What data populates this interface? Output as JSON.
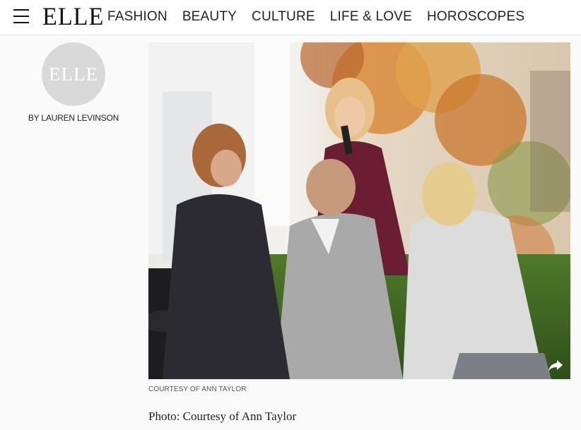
{
  "header": {
    "logo": "ELLE",
    "nav": [
      "FASHION",
      "BEAUTY",
      "CULTURE",
      "LIFE & LOVE",
      "HOROSCOPES"
    ]
  },
  "author": {
    "avatar_text": "ELLE",
    "byline": "BY LAUREN LEVINSON"
  },
  "article": {
    "image_credit": "COURTESY OF ANN TAYLOR",
    "caption": "Photo: Courtesy of Ann Taylor"
  },
  "icons": {
    "menu": "hamburger-menu-icon",
    "share": "share-arrow-icon"
  },
  "colors": {
    "text": "#111111",
    "background": "#fafafa",
    "avatar": "#d9d9d9"
  }
}
